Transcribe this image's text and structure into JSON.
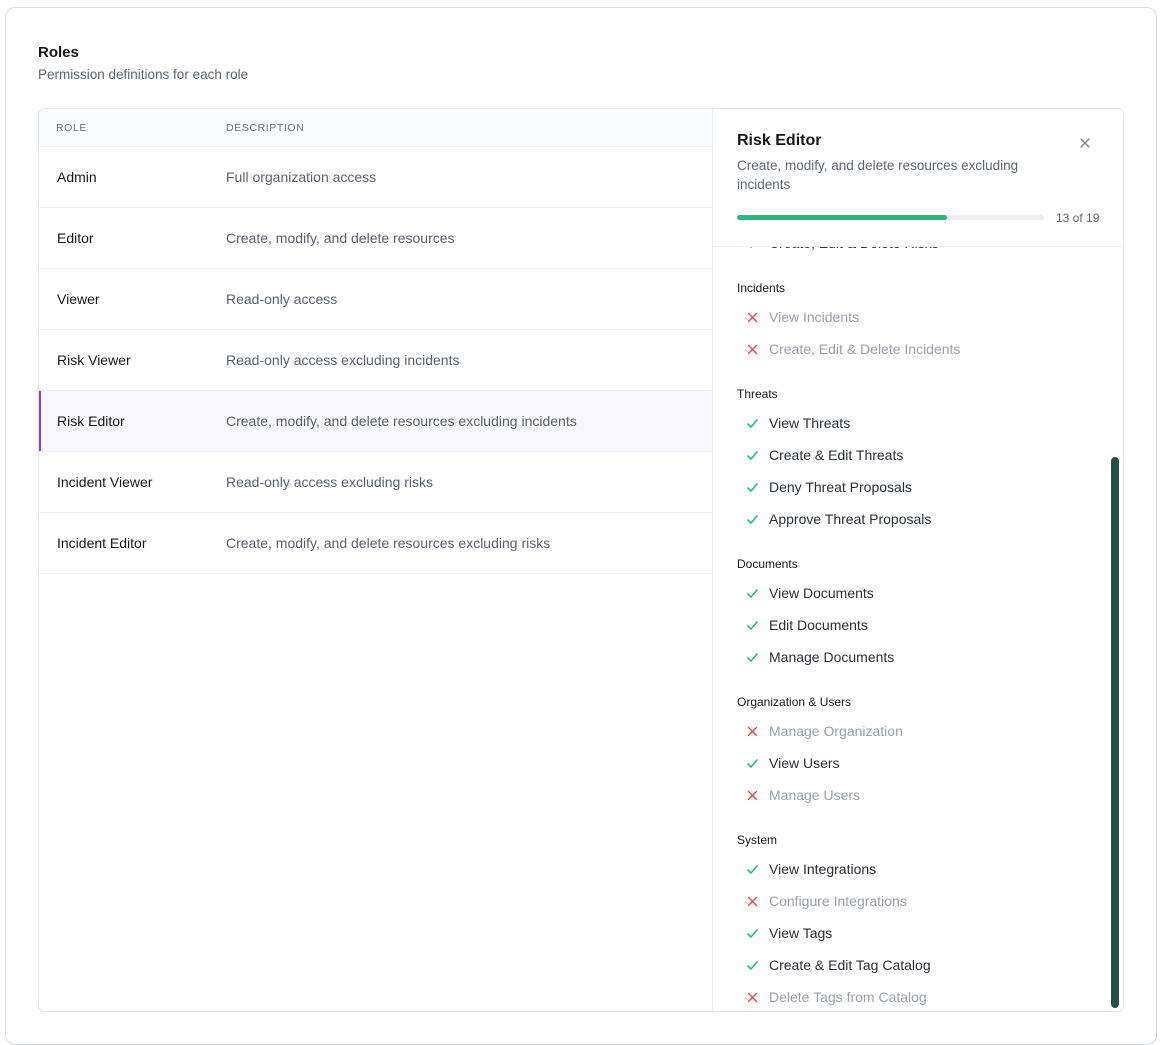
{
  "header": {
    "title": "Roles",
    "subtitle": "Permission definitions for each role"
  },
  "table": {
    "columns": {
      "role": "ROLE",
      "description": "DESCRIPTION"
    },
    "rows": [
      {
        "role": "Admin",
        "description": "Full organization access"
      },
      {
        "role": "Editor",
        "description": "Create, modify, and delete resources"
      },
      {
        "role": "Viewer",
        "description": "Read-only access"
      },
      {
        "role": "Risk Viewer",
        "description": "Read-only access excluding incidents"
      },
      {
        "role": "Risk Editor",
        "description": "Create, modify, and delete resources excluding incidents",
        "selected": true
      },
      {
        "role": "Incident Viewer",
        "description": "Read-only access excluding risks"
      },
      {
        "role": "Incident Editor",
        "description": "Create, modify, and delete resources excluding risks"
      }
    ]
  },
  "detail": {
    "title": "Risk Editor",
    "description": "Create, modify, and delete resources excluding incidents",
    "progress_label": "13 of 19",
    "progress_fraction": 0.684,
    "icons": {
      "close": "close-icon",
      "allowed": "check-icon",
      "denied": "x-icon"
    },
    "colors": {
      "allowed": "#1fbe7f",
      "denied": "#e5484d",
      "accent": "#8a3fd1",
      "scrollbar": "#245248"
    },
    "groups": [
      {
        "title": "",
        "permissions": [
          {
            "label": "Create, Edit & Delete Risks",
            "allowed": true
          }
        ]
      },
      {
        "title": "Incidents",
        "permissions": [
          {
            "label": "View Incidents",
            "allowed": false
          },
          {
            "label": "Create, Edit & Delete Incidents",
            "allowed": false
          }
        ]
      },
      {
        "title": "Threats",
        "permissions": [
          {
            "label": "View Threats",
            "allowed": true
          },
          {
            "label": "Create & Edit Threats",
            "allowed": true
          },
          {
            "label": "Deny Threat Proposals",
            "allowed": true
          },
          {
            "label": "Approve Threat Proposals",
            "allowed": true
          }
        ]
      },
      {
        "title": "Documents",
        "permissions": [
          {
            "label": "View Documents",
            "allowed": true
          },
          {
            "label": "Edit Documents",
            "allowed": true
          },
          {
            "label": "Manage Documents",
            "allowed": true
          }
        ]
      },
      {
        "title": "Organization & Users",
        "permissions": [
          {
            "label": "Manage Organization",
            "allowed": false
          },
          {
            "label": "View Users",
            "allowed": true
          },
          {
            "label": "Manage Users",
            "allowed": false
          }
        ]
      },
      {
        "title": "System",
        "permissions": [
          {
            "label": "View Integrations",
            "allowed": true
          },
          {
            "label": "Configure Integrations",
            "allowed": false
          },
          {
            "label": "View Tags",
            "allowed": true
          },
          {
            "label": "Create & Edit Tag Catalog",
            "allowed": true
          },
          {
            "label": "Delete Tags from Catalog",
            "allowed": false
          }
        ]
      }
    ]
  }
}
